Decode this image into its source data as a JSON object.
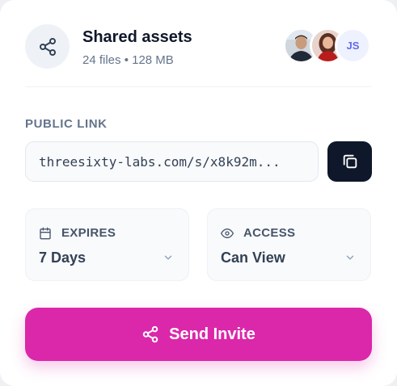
{
  "header": {
    "title": "Shared assets",
    "subtitle": "24 files • 128 MB",
    "icon": "share-icon"
  },
  "collaborators": {
    "avatars": [
      {
        "kind": "photo",
        "description_icon": "avatar-photo-man"
      },
      {
        "kind": "photo",
        "description_icon": "avatar-photo-woman"
      },
      {
        "kind": "initials",
        "initials": "JS"
      }
    ]
  },
  "public_link": {
    "label": "PUBLIC LINK",
    "value": "threesixty-labs.com/s/x8k92m...",
    "copy_icon": "copy-icon"
  },
  "expires": {
    "label": "EXPIRES",
    "value": "7 Days",
    "icon": "calendar-icon"
  },
  "access": {
    "label": "ACCESS",
    "value": "Can View",
    "icon": "eye-icon"
  },
  "send_button": {
    "label": "Send Invite",
    "icon": "share-icon"
  },
  "colors": {
    "accent": "#db27a9",
    "dark_button": "#0f172a",
    "muted_text": "#64748b"
  }
}
